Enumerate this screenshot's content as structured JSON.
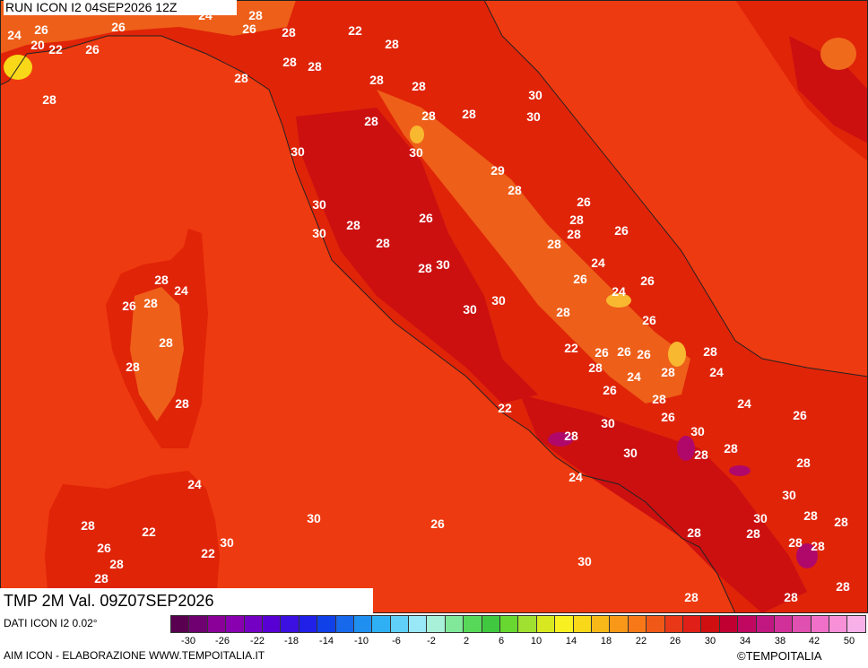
{
  "header": {
    "run_label": "RUN ICON I2 04SEP2026 12Z",
    "variable_label": "TMP 2M Val. 09Z07SEP2026",
    "source_label": "DATI ICON I2 0.02°",
    "credit_label": "AIM ICON - ELABORAZIONE WWW.TEMPOITALIA.IT",
    "brand_label": "©TEMPOITALIA"
  },
  "map": {
    "sea_color": "#ee3a10",
    "land_warm_color": "#e02408",
    "land_hot_color": "#cc1010",
    "hot_spot_color": "#b0086a",
    "mountain_color": "#f06a1c",
    "peak_color": "#f8b830",
    "labels": [
      "24",
      "26",
      "20",
      "22",
      "26",
      "28",
      "24",
      "26",
      "26",
      "28",
      "28",
      "22",
      "28",
      "28",
      "28",
      "28",
      "28",
      "28",
      "28",
      "30",
      "30",
      "28",
      "28",
      "30",
      "30",
      "29",
      "30",
      "30",
      "28",
      "28",
      "26",
      "28",
      "26",
      "28",
      "28",
      "28",
      "26",
      "24",
      "26",
      "28",
      "30",
      "30",
      "30",
      "24",
      "26",
      "28",
      "26",
      "22",
      "26",
      "26",
      "26",
      "28",
      "28",
      "28",
      "24",
      "26",
      "24",
      "28",
      "26",
      "24",
      "26",
      "22",
      "28",
      "30",
      "30",
      "30",
      "28",
      "28",
      "28",
      "24",
      "30",
      "30",
      "28",
      "28",
      "28",
      "28",
      "28",
      "28",
      "28",
      "28",
      "30",
      "28",
      "26",
      "30",
      "28",
      "26",
      "28",
      "28",
      "22",
      "30",
      "22",
      "24",
      "28",
      "28",
      "28",
      "28",
      "26",
      "24",
      "28"
    ]
  },
  "legend": {
    "scale_colors": [
      "#5a0050",
      "#6e0070",
      "#8a0098",
      "#8800b0",
      "#7400c4",
      "#5800d4",
      "#3c10e0",
      "#2020e8",
      "#1040e8",
      "#1868ec",
      "#2090f0",
      "#30b0f4",
      "#60d0f8",
      "#98e8f8",
      "#a8f0d8",
      "#80e898",
      "#58d858",
      "#40c840",
      "#68d830",
      "#a0e030",
      "#d8e820",
      "#f8f020",
      "#f8d818",
      "#f8b818",
      "#f89818",
      "#f87818",
      "#f05818",
      "#e83818",
      "#e02018",
      "#d01010",
      "#c00030",
      "#c00860",
      "#c01880",
      "#d03098",
      "#e050b0",
      "#f070c8",
      "#f890d8",
      "#f8b0e8"
    ],
    "tick_values": [
      "-30",
      "-26",
      "-22",
      "-18",
      "-14",
      "-10",
      "-6",
      "-2",
      "2",
      "6",
      "10",
      "14",
      "18",
      "22",
      "26",
      "30",
      "34",
      "38",
      "42",
      "50"
    ]
  }
}
